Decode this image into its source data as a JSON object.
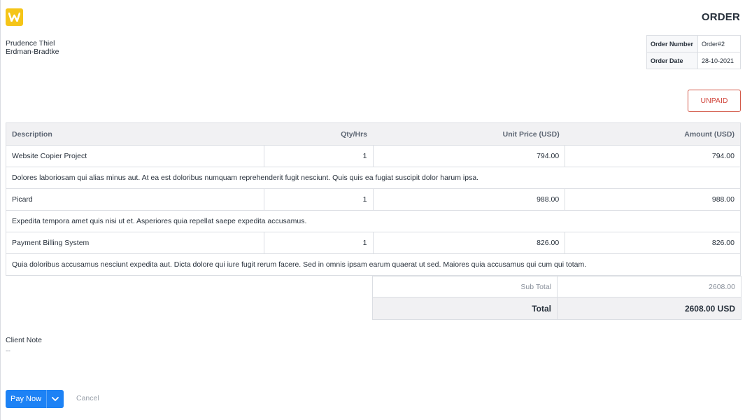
{
  "document": {
    "title": "ORDER",
    "status": "UNPAID",
    "status_color": "#d0443a",
    "logo_letter": "W",
    "logo_color": "#f5c518"
  },
  "client": {
    "name": "Prudence Thiel",
    "company": "Erdman-Bradtke"
  },
  "meta": [
    {
      "label": "Order Number",
      "value": "Order#2"
    },
    {
      "label": "Order Date",
      "value": "28-10-2021"
    }
  ],
  "items_table": {
    "headers": [
      "Description",
      "Qty/Hrs",
      "Unit Price (USD)",
      "Amount (USD)"
    ],
    "rows": [
      {
        "name": "Website Copier Project",
        "qty": "1",
        "unit_price": "794.00",
        "amount": "794.00",
        "description": "Dolores laboriosam qui alias minus aut. At ea est doloribus numquam reprehenderit fugit nesciunt. Quis quis ea fugiat suscipit dolor harum ipsa."
      },
      {
        "name": "Picard",
        "qty": "1",
        "unit_price": "988.00",
        "amount": "988.00",
        "description": "Expedita tempora amet quis nisi ut et. Asperiores quia repellat saepe expedita accusamus."
      },
      {
        "name": "Payment Billing System",
        "qty": "1",
        "unit_price": "826.00",
        "amount": "826.00",
        "description": "Quia doloribus accusamus nesciunt expedita aut. Dicta dolore qui iure fugit rerum facere. Sed in omnis ipsam earum quaerat ut sed. Maiores quia accusamus qui cum qui totam."
      }
    ]
  },
  "totals": {
    "sub_total_label": "Sub Total",
    "sub_total_value": "2608.00",
    "total_label": "Total",
    "total_value": "2608.00 USD"
  },
  "note": {
    "label": "Client Note",
    "value": "--"
  },
  "actions": {
    "pay_label": "Pay Now",
    "cancel_label": "Cancel",
    "primary_color": "#1d82f5"
  }
}
